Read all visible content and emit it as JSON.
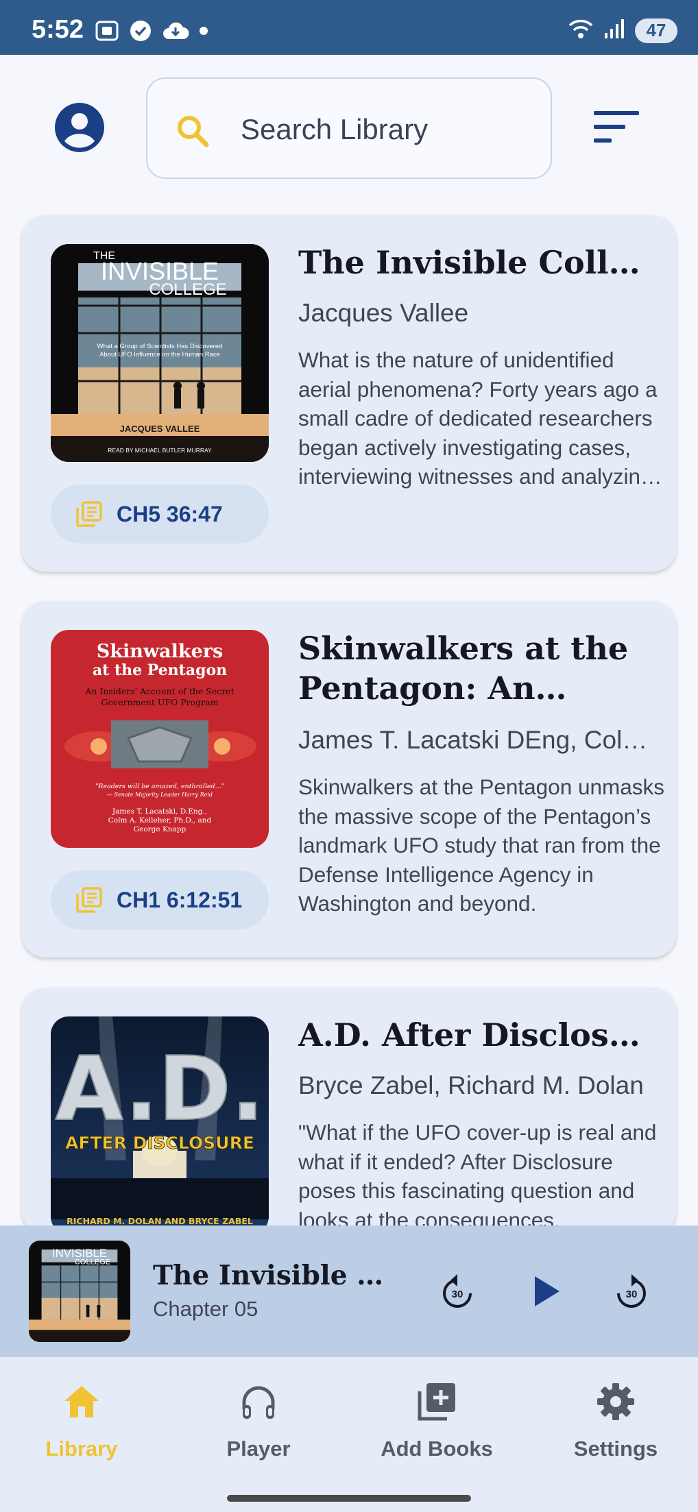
{
  "status_bar": {
    "time": "5:52",
    "battery": "47",
    "icons": [
      "screenshot-icon",
      "check-circle-icon",
      "cloud-download-icon",
      "dot-icon",
      "wifi-icon",
      "signal-icon"
    ]
  },
  "header": {
    "profile_icon": "account-circle-icon",
    "search_placeholder": "Search Library",
    "sort_icon": "sort-icon"
  },
  "books": [
    {
      "title": "The Invisible College",
      "author": "Jacques Vallee",
      "description": "What is the nature of unidentified aerial phenomena? Forty years ago a small cadre of dedicated researchers began actively investigating cases, interviewing witnesses and analyzing the evidence.",
      "progress": "CH5 36:47",
      "cover": {
        "line1": "THE",
        "line2": "INVISIBLE",
        "line3": "COLLEGE",
        "subtitle1": "What a Group of Scientists Has Discovered",
        "subtitle2": "About UFO Influence on the Human Race",
        "author": "JACQUES VALLEE",
        "reader": "READ BY MICHAEL BUTLER MURRAY"
      }
    },
    {
      "title": "Skinwalkers at the Pentagon: An Insiders' Account of the Secret Government UFO Program",
      "author": "James T. Lacatski DEng, Colm A. Kelleher PhD, George Knapp",
      "description": "Skinwalkers at the Pentagon unmasks the massive scope of the Pentagon’s landmark UFO study that ran from the Defense Intelligence Agency in Washington and beyond.",
      "progress": "CH1 6:12:51",
      "cover": {
        "line1": "Skinwalkers",
        "line2": "at the Pentagon",
        "subtitle1": "An Insiders' Account of the Secret",
        "subtitle2": "Government UFO Program",
        "quote": "\"Readers will be amazed, enthralled...\"",
        "quote_by": "— Senate Majority Leader Harry Reid",
        "authors1": "James T. Lacatski, D.Eng.,",
        "authors2": "Colm A. Kelleher, Ph.D., and",
        "authors3": "George Knapp"
      }
    },
    {
      "title": "A.D. After Disclosure",
      "author": "Bryce Zabel, Richard M. Dolan",
      "description": "\"What if the UFO cover-up is real and what if it ended? After Disclosure poses this fascinating question and looks at the consequences.",
      "cover": {
        "big": "A.D.",
        "line": "AFTER DISCLOSURE",
        "authors": "RICHARD M. DOLAN AND BRYCE ZABEL"
      }
    }
  ],
  "mini_player": {
    "title": "The Invisible College",
    "chapter": "Chapter 05",
    "rewind_label": "30",
    "forward_label": "30"
  },
  "nav": [
    {
      "label": "Library",
      "icon": "home-icon",
      "active": true
    },
    {
      "label": "Player",
      "icon": "headphones-icon",
      "active": false
    },
    {
      "label": "Add Books",
      "icon": "add-box-icon",
      "active": false
    },
    {
      "label": "Settings",
      "icon": "gear-icon",
      "active": false
    }
  ],
  "colors": {
    "status_bar": "#2f5b8c",
    "accent": "#f1c232",
    "primary": "#1b3f86",
    "card": "#e6ecf7",
    "mini_player": "#bccde6"
  }
}
